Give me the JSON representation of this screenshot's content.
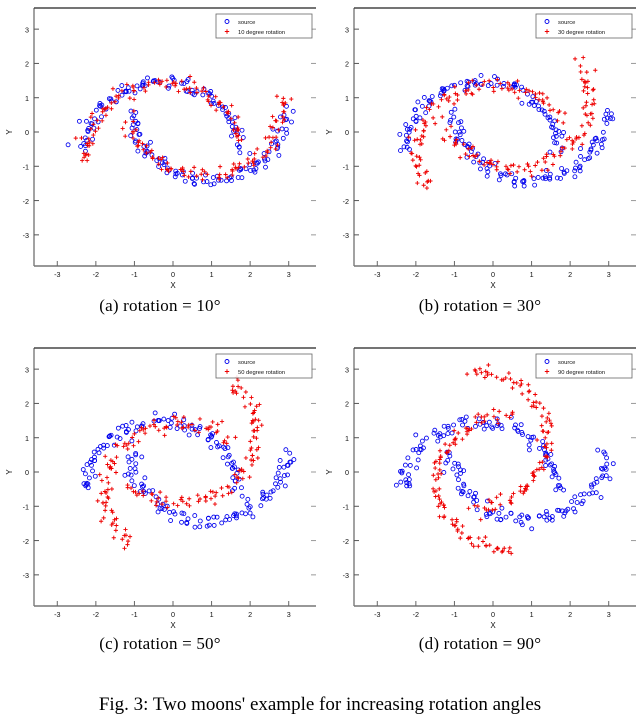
{
  "figure": {
    "caption": "Fig. 3: Two moons' example for increasing rotation angles",
    "panels": [
      {
        "id": "a",
        "subcaption": "(a) rotation = 10°",
        "rotation_deg": 10,
        "legend": {
          "source_label": "source",
          "rotated_label": "10 degree rotation"
        }
      },
      {
        "id": "b",
        "subcaption": "(b) rotation = 30°",
        "rotation_deg": 30,
        "legend": {
          "source_label": "source",
          "rotated_label": "30 degree rotation"
        }
      },
      {
        "id": "c",
        "subcaption": "(c) rotation = 50°",
        "rotation_deg": 50,
        "legend": {
          "source_label": "source",
          "rotated_label": "50 degree rotation"
        }
      },
      {
        "id": "d",
        "subcaption": "(d) rotation = 90°",
        "rotation_deg": 90,
        "legend": {
          "source_label": "source",
          "rotated_label": "90 degree rotation"
        }
      }
    ]
  },
  "chart_data": [
    {
      "type": "scatter",
      "panel": "a",
      "title": "(a) rotation = 10°",
      "xlabel": "X",
      "ylabel": "Y",
      "xlim": [
        -3.5,
        3.5
      ],
      "ylim": [
        -3.5,
        3.5
      ],
      "xticks": [
        -3,
        -2,
        -1,
        0,
        1,
        2,
        3
      ],
      "yticks": [
        -3,
        -2,
        -1,
        0,
        1,
        2,
        3
      ],
      "grid": false,
      "legend_position": "upper right",
      "rotation_deg": 10,
      "series": [
        {
          "name": "source",
          "marker": "circle",
          "color": "#0000ee",
          "n_points": 200
        },
        {
          "name": "10 degree rotation",
          "marker": "plus",
          "color": "#ee0000",
          "n_points": 200
        }
      ]
    },
    {
      "type": "scatter",
      "panel": "b",
      "title": "(b) rotation = 30°",
      "xlabel": "X",
      "ylabel": "Y",
      "xlim": [
        -3.5,
        3.5
      ],
      "ylim": [
        -3.5,
        3.5
      ],
      "xticks": [
        -3,
        -2,
        -1,
        0,
        1,
        2,
        3
      ],
      "yticks": [
        -3,
        -2,
        -1,
        0,
        1,
        2,
        3
      ],
      "grid": false,
      "legend_position": "upper right",
      "rotation_deg": 30,
      "series": [
        {
          "name": "source",
          "marker": "circle",
          "color": "#0000ee",
          "n_points": 200
        },
        {
          "name": "30 degree rotation",
          "marker": "plus",
          "color": "#ee0000",
          "n_points": 200
        }
      ]
    },
    {
      "type": "scatter",
      "panel": "c",
      "title": "(c) rotation = 50°",
      "xlabel": "X",
      "ylabel": "Y",
      "xlim": [
        -3.5,
        3.5
      ],
      "ylim": [
        -3.5,
        3.5
      ],
      "xticks": [
        -3,
        -2,
        -1,
        0,
        1,
        2,
        3
      ],
      "yticks": [
        -3,
        -2,
        -1,
        0,
        1,
        2,
        3
      ],
      "grid": false,
      "legend_position": "upper right",
      "rotation_deg": 50,
      "series": [
        {
          "name": "source",
          "marker": "circle",
          "color": "#0000ee",
          "n_points": 200
        },
        {
          "name": "50 degree rotation",
          "marker": "plus",
          "color": "#ee0000",
          "n_points": 200
        }
      ]
    },
    {
      "type": "scatter",
      "panel": "d",
      "title": "(d) rotation = 90°",
      "xlabel": "X",
      "ylabel": "Y",
      "xlim": [
        -3.5,
        3.5
      ],
      "ylim": [
        -3.5,
        3.5
      ],
      "xticks": [
        -3,
        -2,
        -1,
        0,
        1,
        2,
        3
      ],
      "yticks": [
        -3,
        -2,
        -1,
        0,
        1,
        2,
        3
      ],
      "grid": false,
      "legend_position": "upper right",
      "rotation_deg": 90,
      "series": [
        {
          "name": "source",
          "marker": "circle",
          "color": "#0000ee",
          "n_points": 200
        },
        {
          "name": "90 degree rotation",
          "marker": "plus",
          "color": "#ee0000",
          "n_points": 200
        }
      ]
    }
  ],
  "colors": {
    "source": "#0000ee",
    "rotated": "#ee0000",
    "axis": "#000000",
    "text": "#000000",
    "background": "#ffffff"
  }
}
